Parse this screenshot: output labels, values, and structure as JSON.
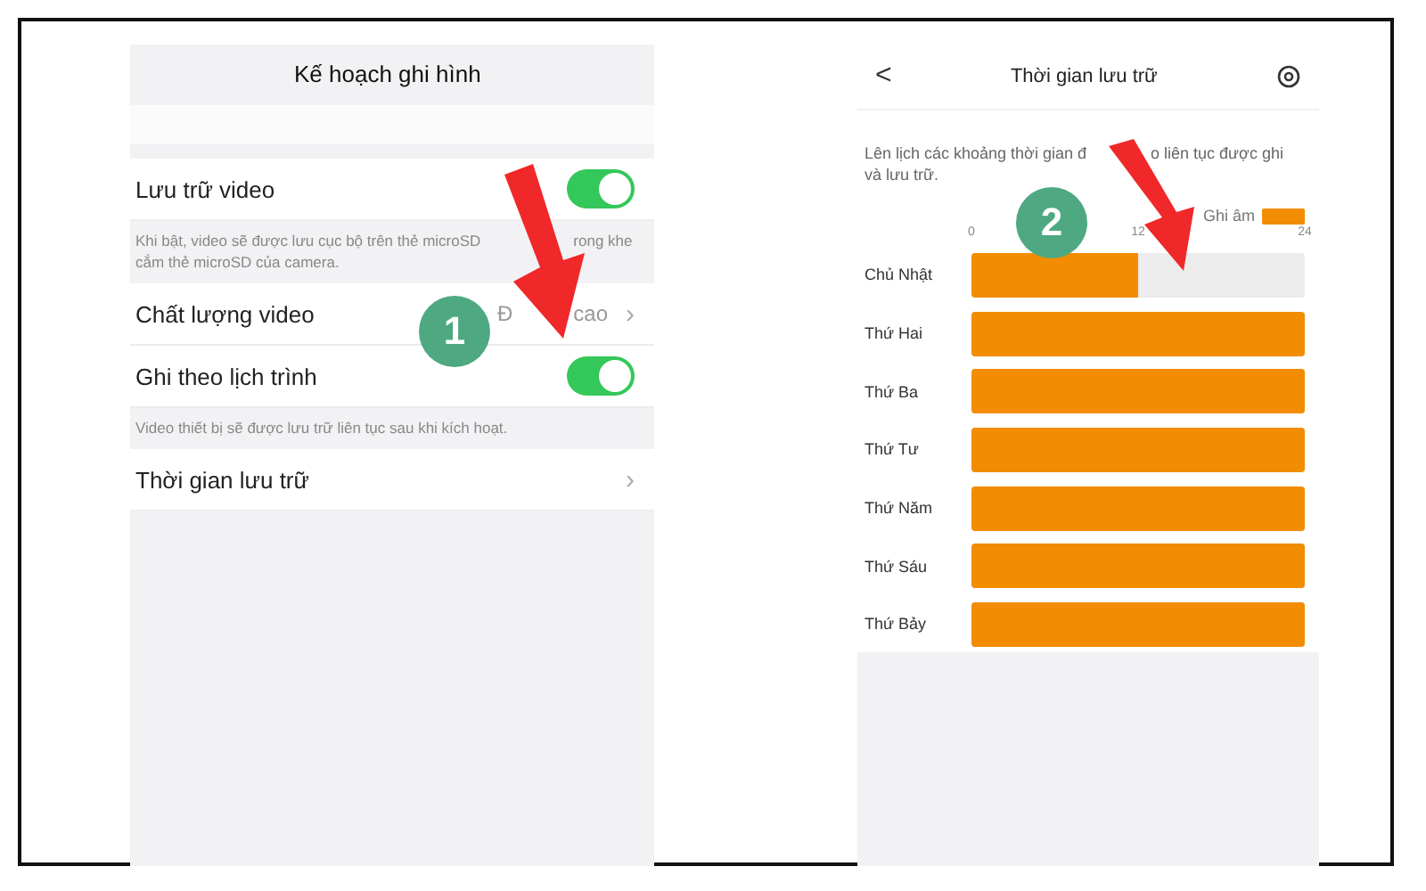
{
  "left_screen": {
    "title": "Kế hoạch ghi hình",
    "rows": [
      {
        "kind": "toggle",
        "label": "Lưu trữ video",
        "on": true,
        "note": [
          [
            "Khi bật, video sẽ được lưu cục bộ trên thẻ microSD",
            "rong khe"
          ],
          [
            "cắm thẻ microSD của camera."
          ]
        ]
      },
      {
        "kind": "value",
        "label": "Chất lượng video",
        "value": [
          "Đ",
          "cao"
        ],
        "chevron": "›"
      },
      {
        "kind": "toggle",
        "label": "Ghi theo lịch trình",
        "on": true,
        "note": [
          [
            "Video thiết bị sẽ được lưu trữ liên tục sau khi kích hoạt."
          ]
        ]
      },
      {
        "kind": "link",
        "label": "Thời gian lưu trữ",
        "chevron": "›"
      }
    ]
  },
  "right_screen": {
    "title": "Thời gian lưu trữ",
    "back": "<",
    "description": [
      [
        "Lên lịch các khoảng thời gian đ",
        "o liên tục được ghi"
      ],
      [
        "và lưu trữ."
      ]
    ],
    "chart_data": {
      "type": "bar",
      "orientation": "horizontal",
      "categories": [
        "Chủ Nhật",
        "Thứ Hai",
        "Thứ Ba",
        "Thứ Tư",
        "Thứ Năm",
        "Thứ Sáu",
        "Thứ Bảy"
      ],
      "xlim": [
        0,
        24
      ],
      "xticks": [
        0,
        12,
        24
      ],
      "series": [
        {
          "name": "Ghi âm",
          "color": "#f28c00",
          "values": [
            12,
            24,
            24,
            24,
            24,
            24,
            24
          ]
        }
      ]
    }
  },
  "annotations": [
    {
      "number": "1"
    },
    {
      "number": "2"
    }
  ]
}
